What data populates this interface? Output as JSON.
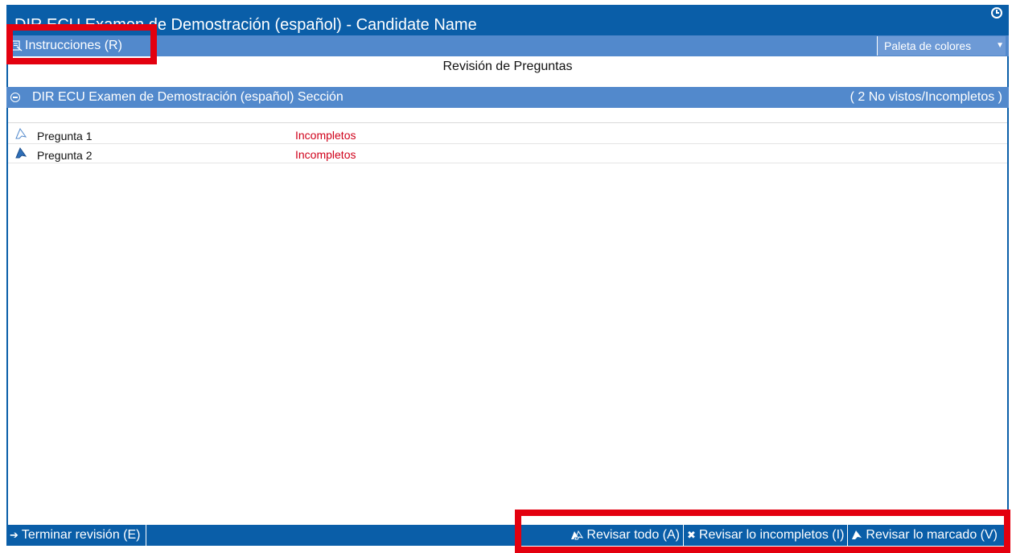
{
  "window": {
    "title": "DIR ECU Examen de Demostración (español) - Candidate Name"
  },
  "toolbar": {
    "instructions_label": "Instrucciones (R)",
    "palette_label": "Paleta de colores"
  },
  "page": {
    "heading": "Revisión de Preguntas"
  },
  "section": {
    "title": "DIR ECU Examen de Demostración (español) Sección",
    "status": "( 2 No vistos/Incompletos )"
  },
  "questions": [
    {
      "label": "Pregunta 1",
      "status": "Incompletos",
      "icon": "flag-outline-icon"
    },
    {
      "label": "Pregunta 2",
      "status": "Incompletos",
      "icon": "flag-filled-icon"
    }
  ],
  "footer": {
    "end_review_label": "Terminar revisión (E)",
    "review_all_label": "Revisar todo (A)",
    "review_incomplete_label": "Revisar lo incompletos (I)",
    "review_flagged_label": "Revisar lo marcado (V)"
  },
  "colors": {
    "title_bar": "#0a5ea8",
    "toolbar": "#5289cc",
    "status_red": "#d0021b",
    "highlight_red": "#e3000f"
  }
}
